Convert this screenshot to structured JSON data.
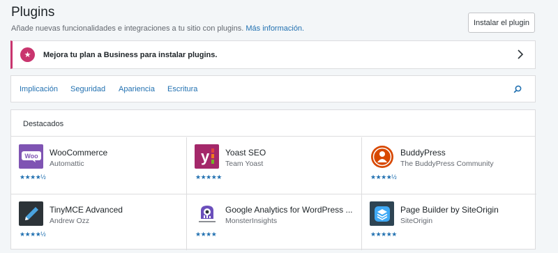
{
  "header": {
    "title": "Plugins",
    "subtitle": "Añade nuevas funcionalidades e integraciones a tu sitio con plugins.",
    "subtitle_link": "Más información.",
    "install_button": "Instalar el plugin"
  },
  "upsell": {
    "text": "Mejora tu plan a Business para instalar plugins.",
    "icon": "star-icon",
    "accent": "#c9356e"
  },
  "nav": {
    "items": [
      "Implicación",
      "Seguridad",
      "Apariencia",
      "Escritura"
    ],
    "search_icon": "search-icon"
  },
  "featured": {
    "heading": "Destacados",
    "plugins": [
      {
        "name": "WooCommerce",
        "author": "Automattic",
        "rating": "★★★★½",
        "color": "#7f54b3"
      },
      {
        "name": "Yoast SEO",
        "author": "Team Yoast",
        "rating": "★★★★★",
        "color": "#a4286a"
      },
      {
        "name": "BuddyPress",
        "author": "The BuddyPress Community",
        "rating": "★★★★½",
        "color": "#d84800"
      },
      {
        "name": "TinyMCE Advanced",
        "author": "Andrew Ozz",
        "rating": "★★★★½",
        "color": "#2c3338"
      },
      {
        "name": "Google Analytics for WordPress ...",
        "author": "MonsterInsights",
        "rating": "★★★★",
        "color": "#6b4fbb"
      },
      {
        "name": "Page Builder by SiteOrigin",
        "author": "SiteOrigin",
        "rating": "★★★★★",
        "color": "#2e4453"
      }
    ]
  }
}
